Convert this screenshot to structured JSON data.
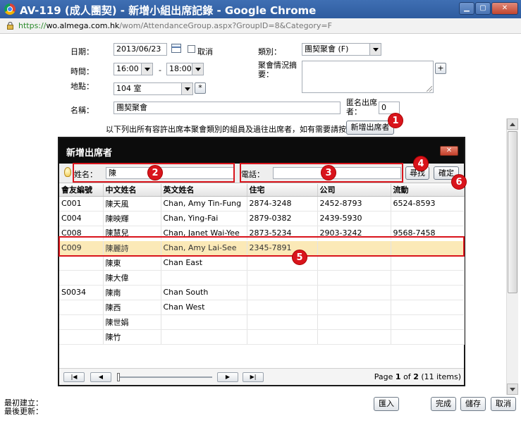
{
  "window": {
    "title": "AV-119 (成人團契) - 新增小組出席記錄 - Google Chrome",
    "url_proto": "https://",
    "url_host": "wo.almega.com.hk",
    "url_path": "/wom/AttendanceGroup.aspx?GroupID=8&Category=F"
  },
  "form": {
    "date_label": "日期：",
    "date_value": "2013/06/23",
    "cancel_label": "取消",
    "time_label": "時間：",
    "time_start": "16:00",
    "time_sep": "-",
    "time_end": "18:00",
    "location_label": "地點：",
    "location_value": "104 室",
    "location_add": "*",
    "name_label": "名稱：",
    "name_value": "團契聚會",
    "category_label": "類別：",
    "category_value": "團契聚會 (F)",
    "summary_label": "聚會情況摘要：",
    "summary_add": "+",
    "anon_label": "匿名出席者：",
    "anon_value": "0",
    "notice": "以下列出所有容許出席本聚會類別的組員及過往出席者，如有需要請按",
    "add_attendee_button": "新增出席者"
  },
  "modal": {
    "title": "新增出席者",
    "close": "✕",
    "search_name_label": "姓名：",
    "search_name_value": "陳",
    "search_phone_label": "電話：",
    "search_phone_value": "",
    "find_button": "尋找",
    "confirm_button": "確定",
    "columns": [
      "會友編號",
      "中文姓名",
      "英文姓名",
      "住宅",
      "公司",
      "流動"
    ],
    "rows": [
      [
        "C001",
        "陳天風",
        "Chan, Amy Tin-Fung",
        "2874-3248",
        "2452-8793",
        "6524-8593"
      ],
      [
        "C004",
        "陳映輝",
        "Chan, Ying-Fai",
        "2879-0382",
        "2439-5930",
        ""
      ],
      [
        "C008",
        "陳慧兒",
        "Chan, Janet Wai-Yee",
        "2873-5234",
        "2903-3242",
        "9568-7458"
      ],
      [
        "C009",
        "陳麗詩",
        "Chan, Amy Lai-See",
        "2345-7891",
        "",
        ""
      ],
      [
        "",
        "陳東",
        "Chan East",
        "",
        "",
        ""
      ],
      [
        "",
        "陳大偉",
        "",
        "",
        "",
        ""
      ],
      [
        "S0034",
        "陳南",
        "Chan South",
        "",
        "",
        ""
      ],
      [
        "",
        "陳西",
        "Chan West",
        "",
        "",
        ""
      ],
      [
        "",
        "陳世娟",
        "",
        "",
        "",
        ""
      ],
      [
        "",
        "陳竹",
        "",
        "",
        "",
        ""
      ]
    ],
    "pager": {
      "first": "|◀",
      "prev": "◀",
      "next": "▶",
      "last": "▶|",
      "page_prefix": "Page ",
      "page_current": "1",
      "page_of": " of ",
      "page_total": "2",
      "items": " (11 items)"
    }
  },
  "annotations": [
    "1",
    "2",
    "3",
    "4",
    "5",
    "6"
  ],
  "footer": {
    "created_label": "最初建立：",
    "updated_label": "最後更新：",
    "import_button": "匯入",
    "done_button": "完成",
    "save_button": "儲存",
    "cancel_button": "取消"
  },
  "colors": {
    "titlebar": "#2f5c9f",
    "modal_header": "#0c0c0c",
    "highlight_row": "#fbe9b7",
    "annotation_red": "#d9141c"
  }
}
